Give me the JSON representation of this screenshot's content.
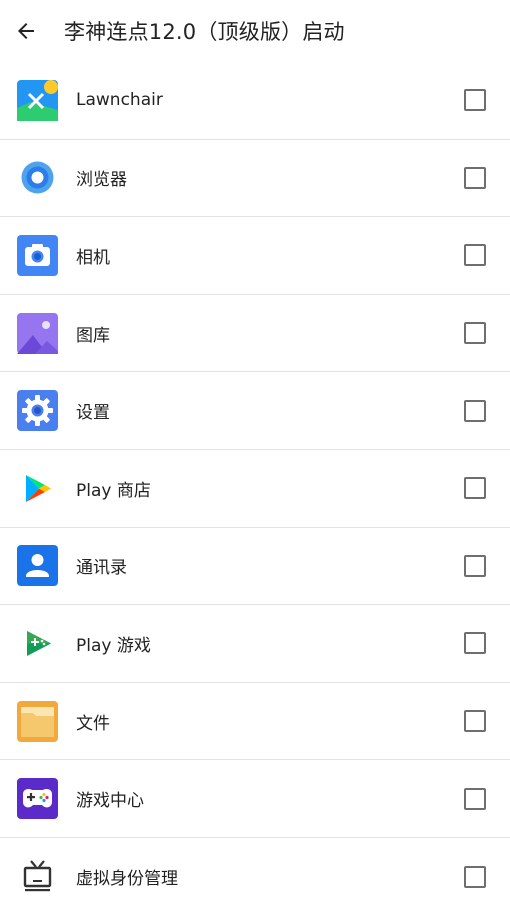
{
  "header": {
    "title": "李神连点12.0（顶级版）启动"
  },
  "apps": [
    {
      "label": "Lawnchair",
      "icon": "lawnchair-icon",
      "checked": false
    },
    {
      "label": "浏览器",
      "icon": "browser-icon",
      "checked": false
    },
    {
      "label": "相机",
      "icon": "camera-icon",
      "checked": false
    },
    {
      "label": "图库",
      "icon": "gallery-icon",
      "checked": false
    },
    {
      "label": "设置",
      "icon": "settings-gear-icon",
      "checked": false
    },
    {
      "label": "Play 商店",
      "icon": "play-store-icon",
      "checked": false
    },
    {
      "label": "通讯录",
      "icon": "contacts-icon",
      "checked": false
    },
    {
      "label": "Play 游戏",
      "icon": "play-games-icon",
      "checked": false
    },
    {
      "label": "文件",
      "icon": "files-folder-icon",
      "checked": false
    },
    {
      "label": "游戏中心",
      "icon": "game-center-icon",
      "checked": false
    },
    {
      "label": "虚拟身份管理",
      "icon": "tv-icon",
      "checked": false
    }
  ],
  "colors": {
    "divider": "#e2e2e2",
    "checkbox_border": "#6e6e6e",
    "text": "#222222"
  }
}
